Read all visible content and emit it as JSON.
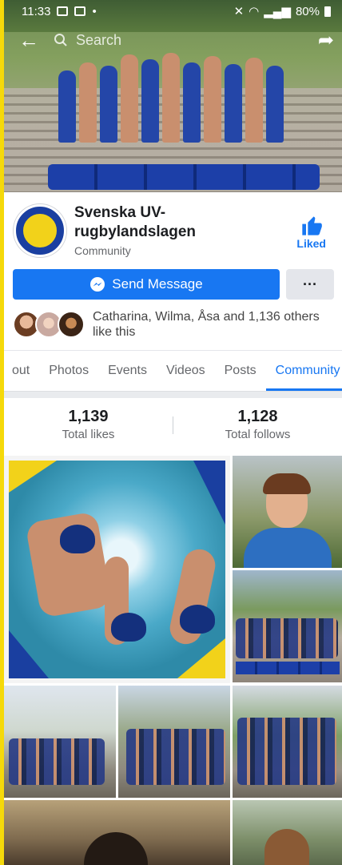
{
  "status_bar": {
    "time": "11:33",
    "battery": "80%"
  },
  "top_bar": {
    "search_placeholder": "Search"
  },
  "page": {
    "name": "Svenska UV-rugbylandslagen",
    "category": "Community",
    "liked_label": "Liked",
    "brand_color": "#1877f2"
  },
  "actions": {
    "send_message": "Send Message",
    "more": "···"
  },
  "friends_like": {
    "text": "Catharina, Wilma, Åsa and 1,136 others like this"
  },
  "tabs": [
    {
      "label": "out"
    },
    {
      "label": "Photos"
    },
    {
      "label": "Events"
    },
    {
      "label": "Videos"
    },
    {
      "label": "Posts"
    },
    {
      "label": "Community",
      "active": true
    }
  ],
  "stats": {
    "likes_value": "1,139",
    "likes_label": "Total likes",
    "follows_value": "1,128",
    "follows_label": "Total follows"
  }
}
